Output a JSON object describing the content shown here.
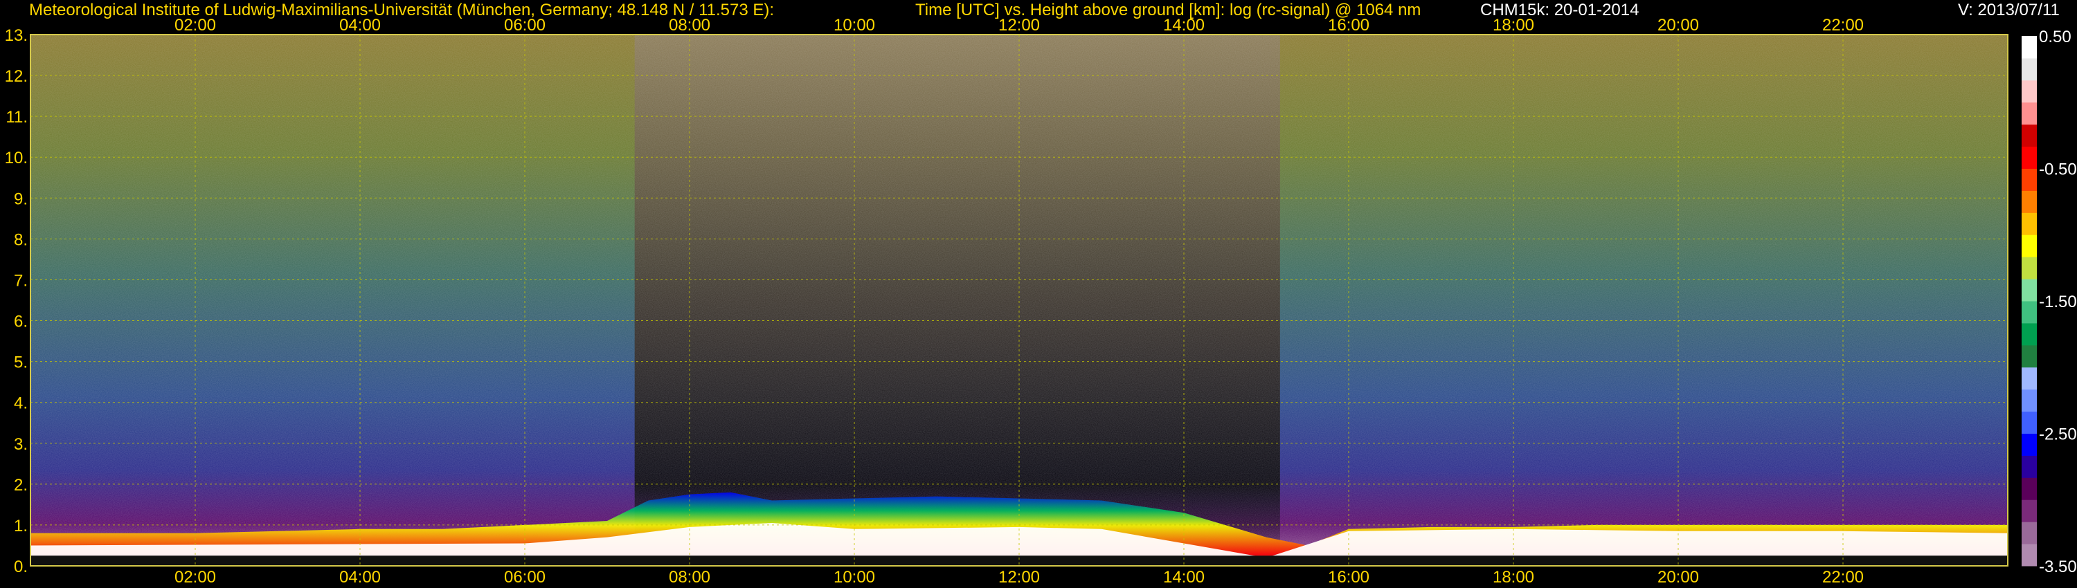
{
  "header": {
    "title": "Meteorological Institute of Ludwig-Maximilians-Universität (München, Germany; 48.148 N / 11.573 E):",
    "axis_title": "Time [UTC] vs. Height above ground [km]: log (rc-signal) @ 1064 nm",
    "instrument": "CHM15k: 20-01-2014",
    "version": "V: 2013/07/11"
  },
  "colors": {
    "background": "#000000",
    "grid": "#c8c800",
    "tick_label": "#ffd700",
    "frame": "#d4c84a"
  },
  "chart_data": {
    "type": "heatmap",
    "title": "Time [UTC] vs. Height above ground [km]: log (rc-signal) @ 1064 nm",
    "xlabel": "Time [UTC]",
    "ylabel": "Height above ground [km]",
    "xlim": [
      "00:00",
      "24:00"
    ],
    "ylim": [
      0,
      13
    ],
    "x_ticks": [
      "02:00",
      "04:00",
      "06:00",
      "08:00",
      "10:00",
      "12:00",
      "14:00",
      "16:00",
      "18:00",
      "20:00",
      "22:00"
    ],
    "y_ticks": [
      "0.",
      "1.",
      "2.",
      "3.",
      "4.",
      "5.",
      "6.",
      "7.",
      "8.",
      "9.",
      "10.",
      "11.",
      "12.",
      "13."
    ],
    "grid": true,
    "colorbar": {
      "range": [
        -3.5,
        0.5
      ],
      "tick_labels": [
        "0.50",
        "-0.50",
        "-1.50",
        "-2.50",
        "-3.50"
      ],
      "tick_values": [
        0.5,
        -0.5,
        -1.5,
        -2.5,
        -3.5
      ],
      "colors_bottom_to_top": [
        "#b08ab0",
        "#9a6a9a",
        "#7a2a7a",
        "#5a005a",
        "#2a00a0",
        "#0000ff",
        "#4060ff",
        "#7090ff",
        "#a0b8ff",
        "#208040",
        "#00a050",
        "#40c080",
        "#80e0a0",
        "#c0e040",
        "#ffff00",
        "#ffc000",
        "#ff8000",
        "#ff4000",
        "#ff0000",
        "#d00000",
        "#ff9090",
        "#ffc8c8",
        "#e8e8e8",
        "#ffffff"
      ]
    },
    "boundary_layer_top_km": {
      "time": [
        "00:00",
        "01:00",
        "02:00",
        "03:00",
        "04:00",
        "05:00",
        "06:00",
        "07:00",
        "07:30",
        "08:00",
        "08:30",
        "09:00",
        "10:00",
        "11:00",
        "12:00",
        "13:00",
        "14:00",
        "15:00",
        "15:30",
        "16:00",
        "17:00",
        "18:00",
        "19:00",
        "20:00",
        "21:00",
        "22:00",
        "23:00",
        "24:00"
      ],
      "height": [
        0.8,
        0.8,
        0.8,
        0.85,
        0.9,
        0.9,
        1.0,
        1.1,
        1.6,
        1.75,
        1.8,
        1.6,
        1.65,
        1.7,
        1.65,
        1.6,
        1.3,
        0.7,
        0.5,
        0.9,
        0.95,
        0.95,
        1.0,
        1.0,
        1.0,
        1.0,
        1.0,
        1.0
      ]
    },
    "aerosol_layer_top_km": {
      "time": [
        "00:00",
        "06:00",
        "07:00",
        "08:00",
        "09:00",
        "10:00",
        "12:00",
        "13:00",
        "14:00",
        "15:00",
        "16:00",
        "18:00",
        "20:00",
        "22:00",
        "24:00"
      ],
      "height": [
        0.5,
        0.55,
        0.7,
        0.95,
        1.05,
        0.9,
        0.95,
        0.9,
        0.55,
        0.2,
        0.85,
        0.9,
        0.85,
        0.85,
        0.8
      ]
    }
  }
}
